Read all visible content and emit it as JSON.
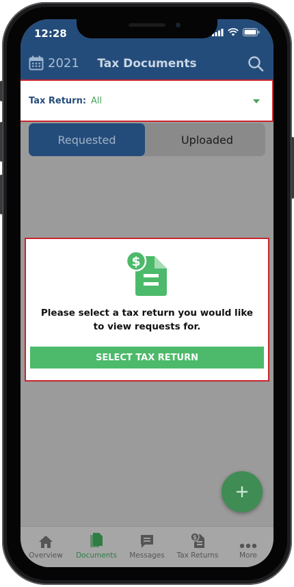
{
  "status_bar": {
    "time": "12:28"
  },
  "header": {
    "year": "2021",
    "title": "Tax Documents"
  },
  "filter": {
    "label": "Tax Return:",
    "value": "All"
  },
  "segment": {
    "requested": "Requested",
    "uploaded": "Uploaded",
    "selected": "Requested"
  },
  "empty_state": {
    "message": "Please select a tax return you would like to view requests for.",
    "button": "SELECT TAX RETURN",
    "icon": "tax-document-dollar-icon"
  },
  "fab": {
    "icon": "plus-icon"
  },
  "tabbar": {
    "items": [
      {
        "label": "Overview",
        "icon": "home-icon"
      },
      {
        "label": "Documents",
        "icon": "documents-icon"
      },
      {
        "label": "Messages",
        "icon": "message-icon"
      },
      {
        "label": "Tax Returns",
        "icon": "tax-return-icon"
      },
      {
        "label": "More",
        "icon": "more-dots-icon"
      }
    ],
    "active": "Documents"
  },
  "colors": {
    "header": "#244c7a",
    "accent_green": "#4cba6a",
    "highlight_border": "#c8262d"
  }
}
